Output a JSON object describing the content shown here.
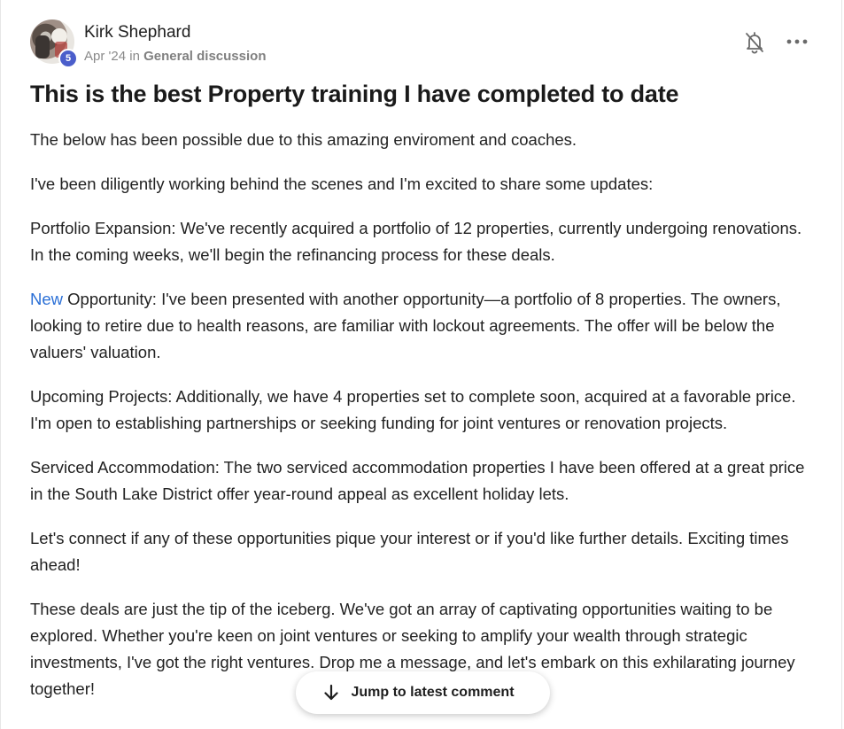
{
  "post": {
    "author": {
      "name": "Kirk Shephard",
      "level": "5"
    },
    "meta": {
      "date": "Apr '24",
      "in_word": "in",
      "category": "General discussion"
    },
    "title": "This is the best Property training I have completed to date",
    "paragraphs": {
      "p1": "The below has been possible due to this amazing enviroment and coaches.",
      "p2": "I've been diligently working behind the scenes and I'm excited to share some updates:",
      "p3": "Portfolio Expansion: We've recently acquired a portfolio of 12 properties, currently undergoing renovations. In the coming weeks, we'll begin the refinancing process for these deals.",
      "p4_link": "New",
      "p4_rest": " Opportunity: I've been presented with another opportunity—a portfolio of 8 properties. The owners, looking to retire due to health reasons, are familiar with lockout agreements. The offer will be below the valuers' valuation.",
      "p5": "Upcoming Projects: Additionally, we have 4 properties set to complete soon, acquired at a favorable price. I'm open to establishing partnerships or seeking funding for joint ventures or renovation projects.",
      "p6": "Serviced Accommodation: The two serviced accommodation properties I have been offered at a great price in the South Lake District offer year-round appeal as excellent holiday lets.",
      "p7": "Let's connect if any of these opportunities pique your interest or if you'd like further details. Exciting times ahead!",
      "p8": "These deals are just the tip of the iceberg. We've got an array of captivating opportunities waiting to be explored. Whether you're keen on joint ventures or seeking to amplify your wealth through strategic investments, I've got the right ventures. Drop me a message, and let's embark on this exhilarating journey together!"
    }
  },
  "actions": {
    "notifications_icon": "bell-off-icon",
    "more_icon": "more-horizontal-icon",
    "jump_label": "Jump to latest comment",
    "jump_icon": "arrow-down-icon"
  },
  "colors": {
    "badge": "#4b5ecb",
    "link": "#2a6fd6"
  }
}
